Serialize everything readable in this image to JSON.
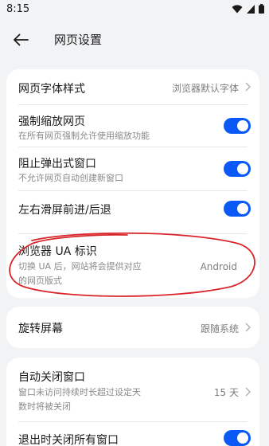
{
  "status_bar": {
    "time": "8:15"
  },
  "header": {
    "title": "网页设置",
    "back_icon": "arrow-left-icon"
  },
  "section1": {
    "font_style": {
      "title": "网页字体样式",
      "value": "浏览器默认字体"
    },
    "force_zoom": {
      "title": "强制缩放网页",
      "subtitle": "在所有网页强制允许使用缩放功能",
      "enabled": true
    },
    "block_popups": {
      "title": "阻止弹出式窗口",
      "subtitle": "不允许网页自动创建新窗口",
      "enabled": true
    },
    "swipe_nav": {
      "title": "左右滑屏前进/后退",
      "enabled": true
    },
    "user_agent": {
      "title": "浏览器 UA 标识",
      "subtitle_line1": "切换 UA 后，网站将会提供对应",
      "subtitle_line2": "的网页版式",
      "value": "Android"
    }
  },
  "section2": {
    "rotate": {
      "title": "旋转屏幕",
      "value": "跟随系统"
    }
  },
  "section3": {
    "auto_close": {
      "title": "自动关闭窗口",
      "subtitle_line1": "窗口未访问持续时长超过设定天",
      "subtitle_line2": "数时将被关闭",
      "value": "15 天"
    },
    "close_all_on_exit": {
      "title": "退出时关闭所有窗口",
      "enabled": true
    }
  },
  "colors": {
    "accent": "#0a59f7",
    "background": "#f1f3f5",
    "annotation": "#d9252a"
  }
}
